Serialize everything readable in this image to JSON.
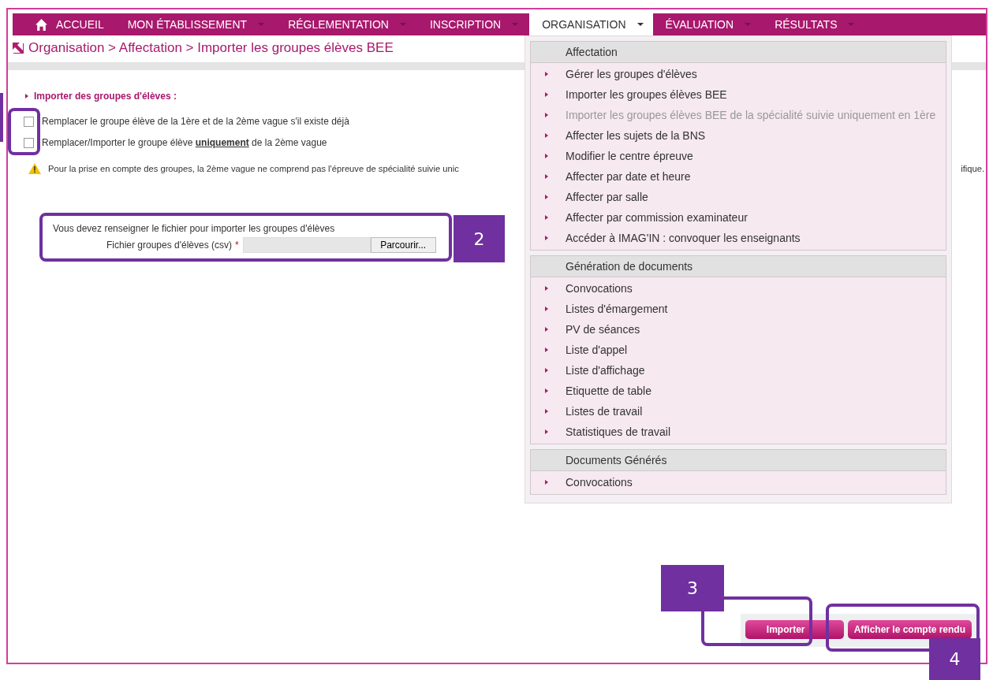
{
  "nav": {
    "items": [
      {
        "label": "ACCUEIL",
        "kind": "home",
        "selected": false
      },
      {
        "label": "MON ÉTABLISSEMENT",
        "kind": "dropdown",
        "selected": false
      },
      {
        "label": "RÉGLEMENTATION",
        "kind": "dropdown",
        "selected": false
      },
      {
        "label": "INSCRIPTION",
        "kind": "dropdown",
        "selected": false
      },
      {
        "label": "ORGANISATION",
        "kind": "dropdown",
        "selected": true
      },
      {
        "label": "ÉVALUATION",
        "kind": "dropdown",
        "selected": false
      },
      {
        "label": "RÉSULTATS",
        "kind": "dropdown",
        "selected": false
      }
    ]
  },
  "breadcrumb": "Organisation > Affectation > Importer les groupes élèves BEE",
  "section_title": "Importer des groupes d'élèves :",
  "options": [
    {
      "label": "Remplacer le groupe élève de la 1ère et de la 2ème vague s'il existe déjà",
      "checked": false
    },
    {
      "label": "Remplacer/Importer le groupe élève **uniquement** de la 2ème vague",
      "checked": false
    }
  ],
  "warning": {
    "text_start": "Pour la prise en compte des groupes, la 2ème vague ne comprend pas l'épreuve de spécialité suivie unic",
    "text_end": "ifique."
  },
  "file_form": {
    "instruction": "Vous devez renseigner le fichier pour importer les groupes d'élèves",
    "label": "Fichier groupes d'élèves (csv)",
    "required_mark": "*",
    "browse_button": "Parcourir..."
  },
  "menu": {
    "sections": [
      {
        "title": "Affectation",
        "items": [
          {
            "label": "Gérer les groupes d'élèves",
            "disabled": false
          },
          {
            "label": "Importer les groupes élèves BEE",
            "disabled": false
          },
          {
            "label": "Importer les groupes élèves BEE de la spécialité suivie uniquement en 1ère",
            "disabled": true
          },
          {
            "label": "Affecter les sujets de la BNS",
            "disabled": false
          },
          {
            "label": "Modifier le centre épreuve",
            "disabled": false
          },
          {
            "label": "Affecter par date et heure",
            "disabled": false
          },
          {
            "label": "Affecter par salle",
            "disabled": false
          },
          {
            "label": "Affecter par commission examinateur",
            "disabled": false
          },
          {
            "label": "Accéder à IMAG'IN : convoquer les enseignants",
            "disabled": false
          }
        ]
      },
      {
        "title": "Génération de documents",
        "items": [
          {
            "label": "Convocations",
            "disabled": false
          },
          {
            "label": "Listes d'émargement",
            "disabled": false
          },
          {
            "label": "PV de séances",
            "disabled": false
          },
          {
            "label": "Liste d'appel",
            "disabled": false
          },
          {
            "label": "Liste d'affichage",
            "disabled": false
          },
          {
            "label": "Etiquette de table",
            "disabled": false
          },
          {
            "label": "Listes de travail",
            "disabled": false
          },
          {
            "label": "Statistiques de travail",
            "disabled": false
          }
        ]
      },
      {
        "title": "Documents Générés",
        "items": [
          {
            "label": "Convocations",
            "disabled": false
          }
        ]
      }
    ]
  },
  "buttons": [
    "Importer",
    "Afficher le compte rendu"
  ],
  "callouts": [
    {
      "badge_cut": true
    },
    {
      "badge": "2"
    },
    {
      "badge": "3"
    },
    {
      "badge": "4"
    }
  ]
}
